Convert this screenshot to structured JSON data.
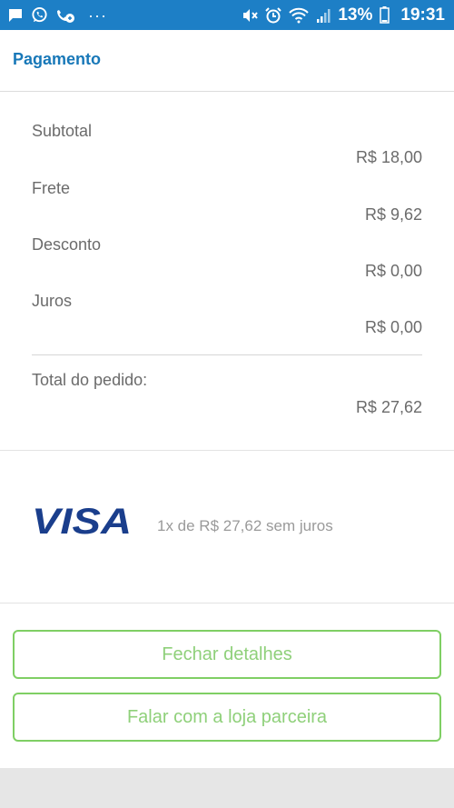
{
  "status_bar": {
    "battery_percent": "13%",
    "time": "19:31",
    "dots": "···",
    "icons": [
      "message-icon",
      "whatsapp-icon",
      "missed-call-icon",
      "mute-icon",
      "alarm-icon",
      "wifi-icon",
      "signal-icon",
      "battery-icon"
    ]
  },
  "header": {
    "title": "Pagamento",
    "title_color": "#1878b8"
  },
  "summary": {
    "subtotal": {
      "label": "Subtotal",
      "value": "R$ 18,00"
    },
    "frete": {
      "label": "Frete",
      "value": "R$ 9,62"
    },
    "desconto": {
      "label": "Desconto",
      "value": "R$ 0,00"
    },
    "juros": {
      "label": "Juros",
      "value": "R$ 0,00"
    },
    "total": {
      "label": "Total do pedido:",
      "value": "R$ 27,62"
    }
  },
  "payment": {
    "brand": "VISA",
    "installments": "1x de R$ 27,62 sem juros"
  },
  "buttons": {
    "close_label": "Fechar detalhes",
    "talk_label": "Falar com a loja parceira"
  },
  "colors": {
    "status_bar": "#1d7fc6",
    "button_border": "#7fcf64",
    "visa_blue": "#1a3e8c"
  }
}
